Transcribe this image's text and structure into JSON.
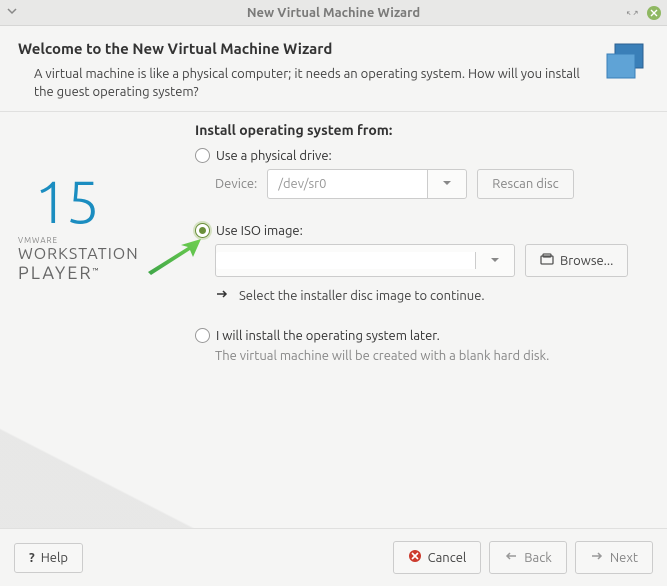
{
  "window": {
    "title": "New Virtual Machine Wizard"
  },
  "header": {
    "title": "Welcome to the New Virtual Machine Wizard",
    "description": "A virtual machine is like a physical computer; it needs an operating system. How will you install the guest operating system?"
  },
  "logo": {
    "version": "15",
    "vendor": "VMWARE",
    "product1": "WORKSTATION",
    "product2": "PLAYER",
    "tm": "™"
  },
  "main": {
    "section_heading": "Install operating system from:",
    "opt_physical": {
      "label": "Use a physical drive:",
      "device_label": "Device:",
      "device_value": "/dev/sr0",
      "rescan_label": "Rescan disc"
    },
    "opt_iso": {
      "label": "Use ISO image:",
      "value": "",
      "browse_label": "Browse...",
      "hint": "Select the installer disc image to continue."
    },
    "opt_later": {
      "label": "I will install the operating system later.",
      "hint": "The virtual machine will be created with a blank hard disk."
    }
  },
  "footer": {
    "help": "Help",
    "cancel": "Cancel",
    "back": "Back",
    "next": "Next"
  }
}
